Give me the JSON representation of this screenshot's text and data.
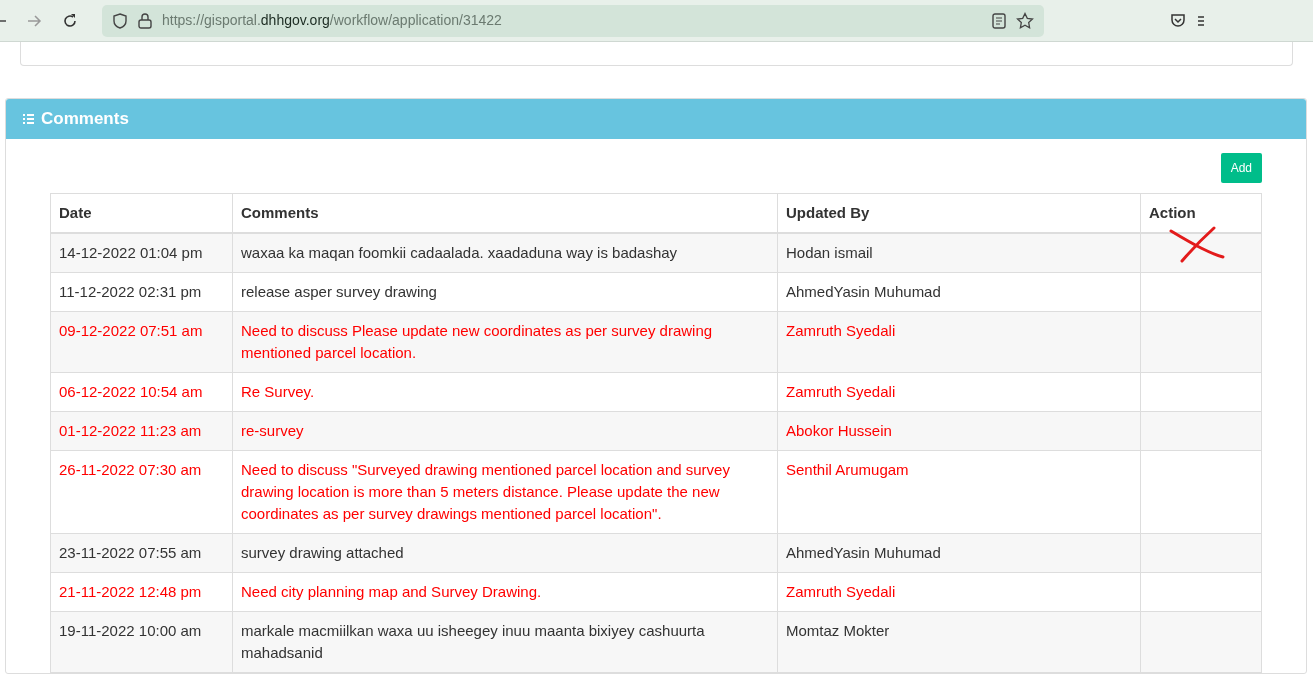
{
  "browser": {
    "url_prefix": "https://gisportal.",
    "url_domain": "dhhgov.org",
    "url_path": "/workflow/application/31422"
  },
  "panel": {
    "title": "Comments",
    "add_button": "Add"
  },
  "table": {
    "columns": [
      "Date",
      "Comments",
      "Updated By",
      "Action"
    ],
    "rows": [
      {
        "date": "14-12-2022 01:04 pm",
        "comment": "waxaa ka maqan foomkii cadaalada. xaadaduna way is badashay",
        "updated_by": "Hodan ismail",
        "highlighted": false,
        "crossed": true
      },
      {
        "date": "11-12-2022 02:31 pm",
        "comment": "release asper survey drawing",
        "updated_by": "AhmedYasin Muhumad",
        "highlighted": false,
        "crossed": false
      },
      {
        "date": "09-12-2022 07:51 am",
        "comment": "Need to discuss Please update new coordinates as per survey drawing mentioned parcel location.",
        "updated_by": "Zamruth Syedali",
        "highlighted": true,
        "crossed": false
      },
      {
        "date": "06-12-2022 10:54 am",
        "comment": "Re Survey.",
        "updated_by": "Zamruth Syedali",
        "highlighted": true,
        "crossed": false
      },
      {
        "date": "01-12-2022 11:23 am",
        "comment": "re-survey",
        "updated_by": "Abokor Hussein",
        "highlighted": true,
        "crossed": false
      },
      {
        "date": "26-11-2022 07:30 am",
        "comment": "Need to discuss \"Surveyed drawing mentioned parcel location and survey drawing location is more than 5 meters distance. Please update the new coordinates as per survey drawings mentioned parcel location\".",
        "updated_by": "Senthil Arumugam",
        "highlighted": true,
        "crossed": false
      },
      {
        "date": "23-11-2022 07:55 am",
        "comment": "survey drawing attached",
        "updated_by": "AhmedYasin Muhumad",
        "highlighted": false,
        "crossed": false
      },
      {
        "date": "21-11-2022 12:48 pm",
        "comment": "Need city planning map and Survey Drawing.",
        "updated_by": "Zamruth Syedali",
        "highlighted": true,
        "crossed": false
      },
      {
        "date": "19-11-2022 10:00 am",
        "comment": "markale macmiilkan waxa uu isheegey inuu maanta bixiyey cashuurta mahadsanid",
        "updated_by": "Momtaz Mokter",
        "highlighted": false,
        "crossed": false
      }
    ]
  }
}
